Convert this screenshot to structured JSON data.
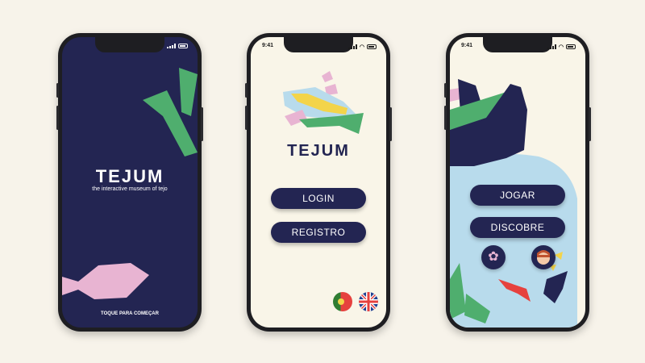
{
  "colors": {
    "navy": "#232552",
    "cream": "#f9f5e8",
    "background": "#f7f3ea",
    "green": "#4fae6e",
    "pink": "#e8b4d2",
    "light_blue": "#b8dbec",
    "yellow": "#f3d44a",
    "red": "#e6413e"
  },
  "splash": {
    "logo": "TEJUM",
    "tagline": "the interactive museum of tejo",
    "tap_prompt": "TOQUE PARA COMEÇAR"
  },
  "login": {
    "time": "9:41",
    "logo": "TEJUM",
    "login_label": "LOGIN",
    "register_label": "REGISTRO",
    "languages": [
      "portugal-flag-icon",
      "uk-flag-icon"
    ]
  },
  "menu": {
    "time": "9:41",
    "play_label": "JOGAR",
    "discover_label": "DISCOBRE",
    "settings_icon": "gear-icon",
    "profile_icon": "avatar-icon"
  }
}
